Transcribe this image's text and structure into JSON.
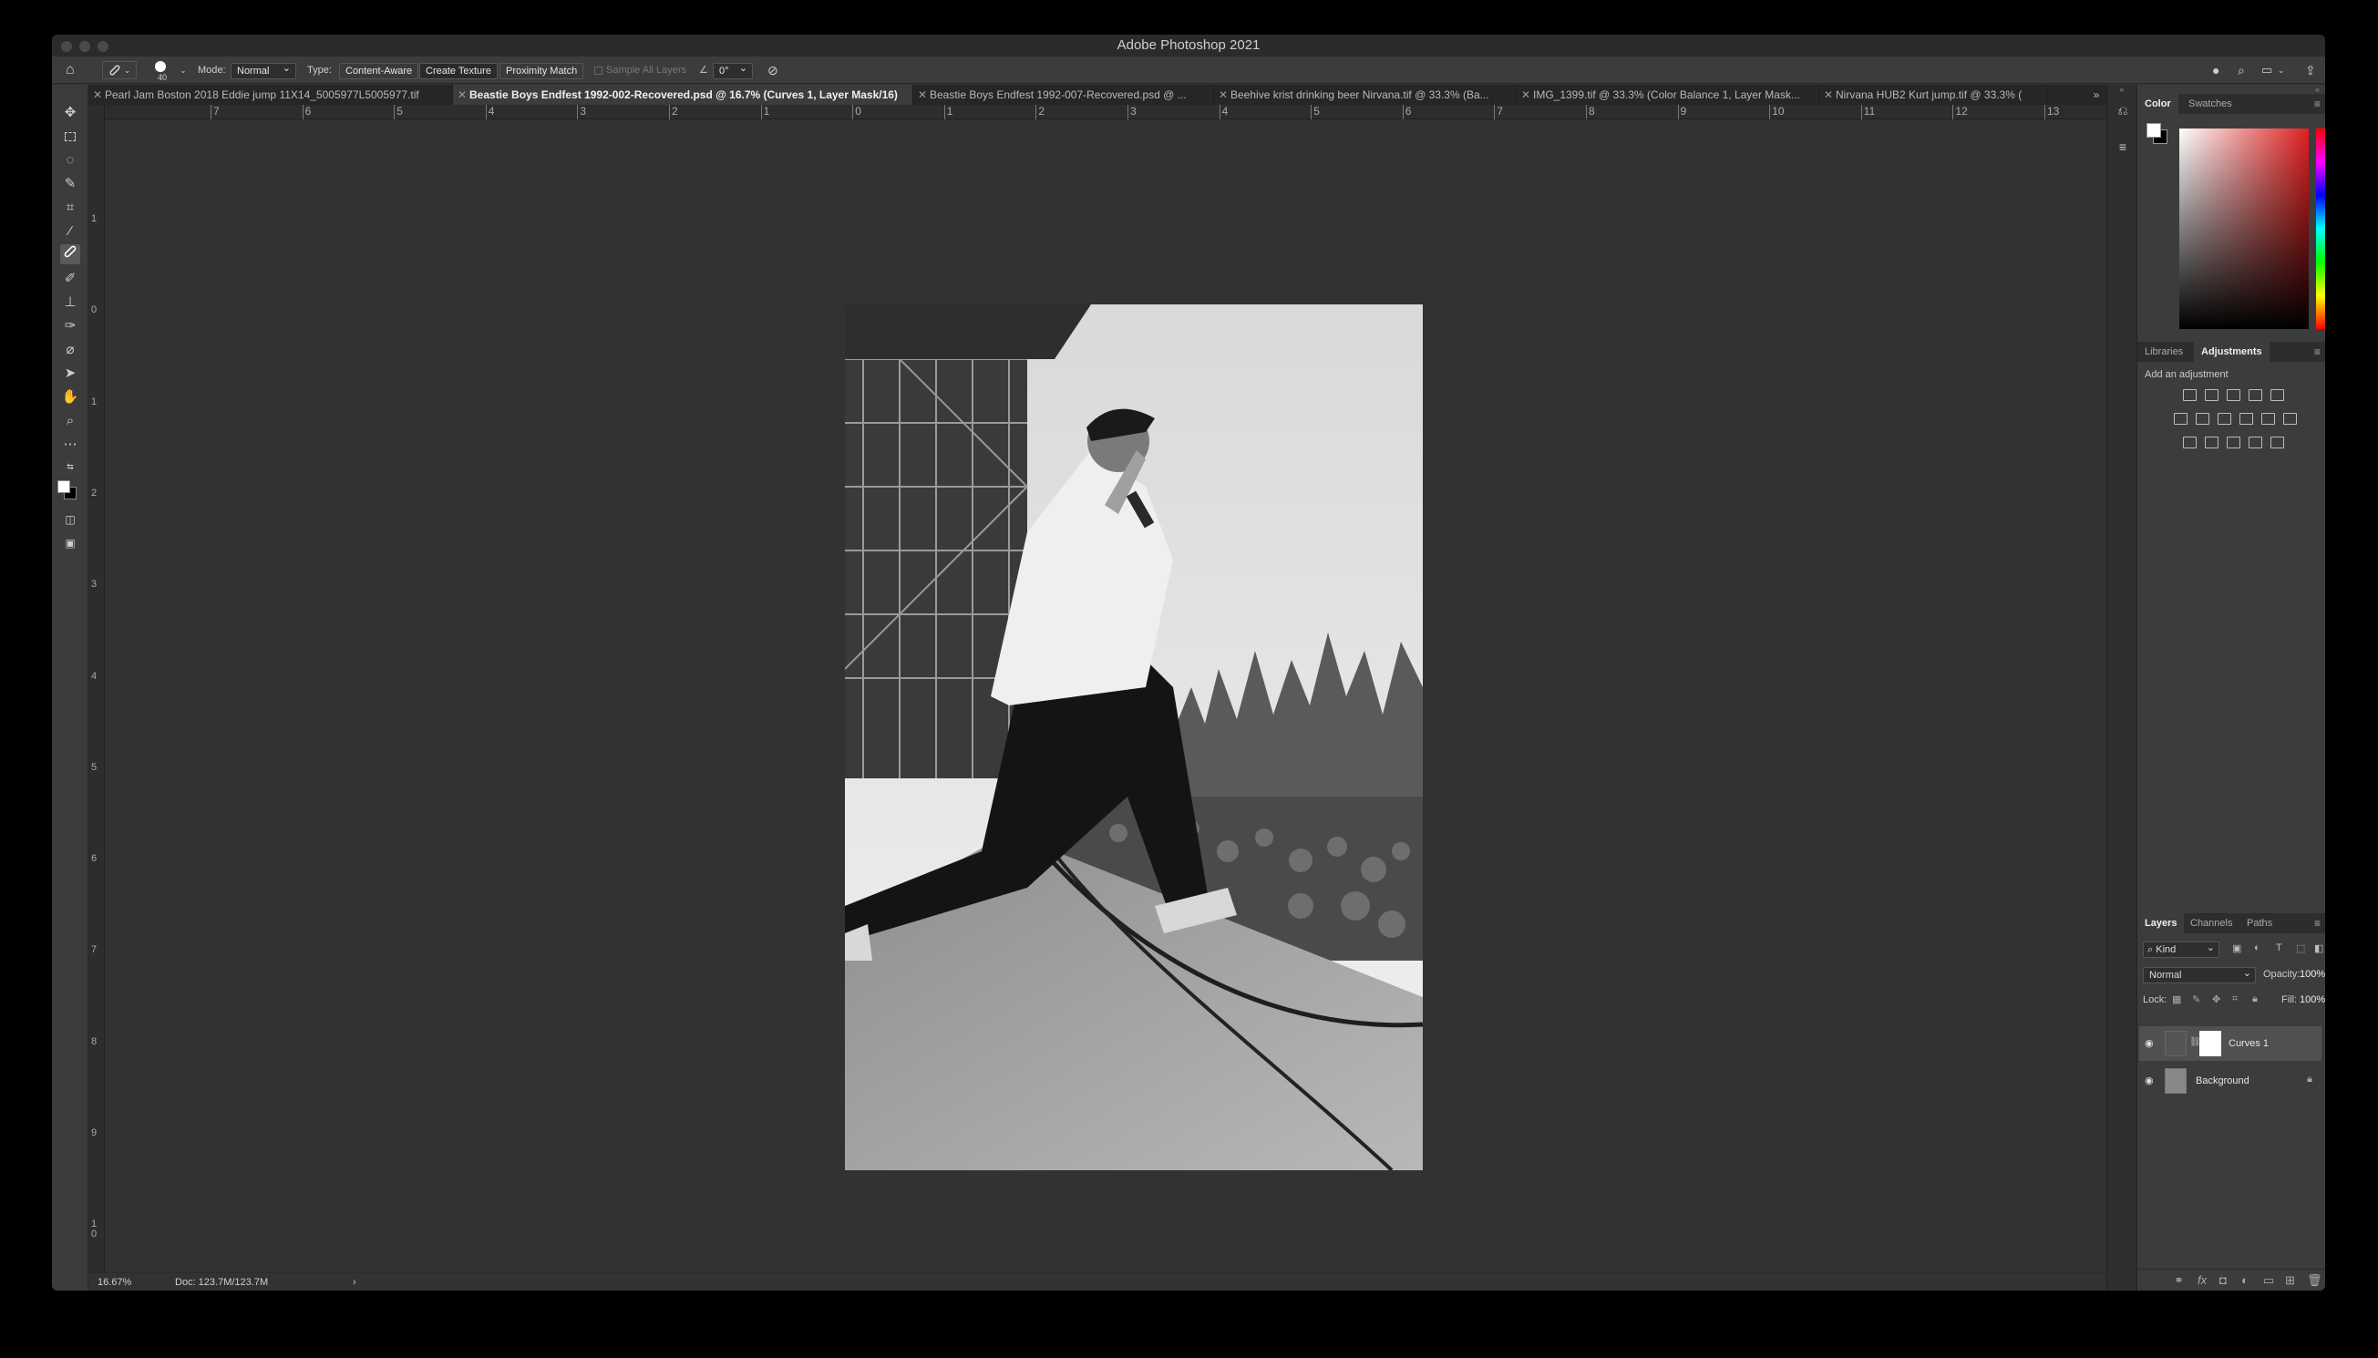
{
  "window": {
    "title": "Adobe Photoshop 2021"
  },
  "options_bar": {
    "brush_size": "40",
    "mode_label": "Mode:",
    "mode_value": "Normal",
    "type_label": "Type:",
    "type_options": [
      "Content-Aware",
      "Create Texture",
      "Proximity Match"
    ],
    "sample_all_layers": "Sample All Layers",
    "angle_value": "0°"
  },
  "tabs": [
    {
      "label": "Pearl Jam Boston 2018 Eddie jump 11X14_5005977L5005977.tif",
      "active": false
    },
    {
      "label": "Beastie Boys Endfest 1992-002-Recovered.psd @ 16.7% (Curves 1, Layer Mask/16)",
      "active": true
    },
    {
      "label": "Beastie Boys Endfest 1992-007-Recovered.psd @ ...",
      "active": false
    },
    {
      "label": "Beehive krist drinking beer Nirvana.tif @ 33.3% (Ba...",
      "active": false
    },
    {
      "label": "IMG_1399.tif @ 33.3% (Color Balance 1, Layer Mask...",
      "active": false
    },
    {
      "label": "Nirvana HUB2 Kurt jump.tif @ 33.3% (",
      "active": false
    }
  ],
  "ruler_h": [
    "7",
    "6",
    "5",
    "4",
    "3",
    "2",
    "1",
    "0",
    "1",
    "2",
    "3",
    "4",
    "5",
    "6",
    "7",
    "8",
    "9",
    "10",
    "11",
    "12",
    "13"
  ],
  "ruler_v": [
    "1",
    "0",
    "1",
    "2",
    "3",
    "4",
    "5",
    "6",
    "7",
    "8",
    "9",
    "1\n0"
  ],
  "status": {
    "zoom": "16.67%",
    "doc": "Doc: 123.7M/123.7M"
  },
  "color_panel": {
    "tabs": [
      "Color",
      "Swatches"
    ],
    "active": "Color"
  },
  "adjustments_panel": {
    "tabs": [
      "Libraries",
      "Adjustments"
    ],
    "active": "Adjustments",
    "hint": "Add an adjustment"
  },
  "layers_panel": {
    "tabs": [
      "Layers",
      "Channels",
      "Paths"
    ],
    "active": "Layers",
    "filter": "Kind",
    "blend_mode": "Normal",
    "opacity_label": "Opacity:",
    "opacity_value": "100%",
    "lock_label": "Lock:",
    "fill_label": "Fill:",
    "fill_value": "100%",
    "layers": [
      {
        "name": "Curves 1",
        "selected": true
      },
      {
        "name": "Background",
        "selected": false
      }
    ]
  },
  "colors": {
    "accent": "#2d7ce2",
    "app_bg": "#323232",
    "panel_bg": "#3c3c3c"
  }
}
